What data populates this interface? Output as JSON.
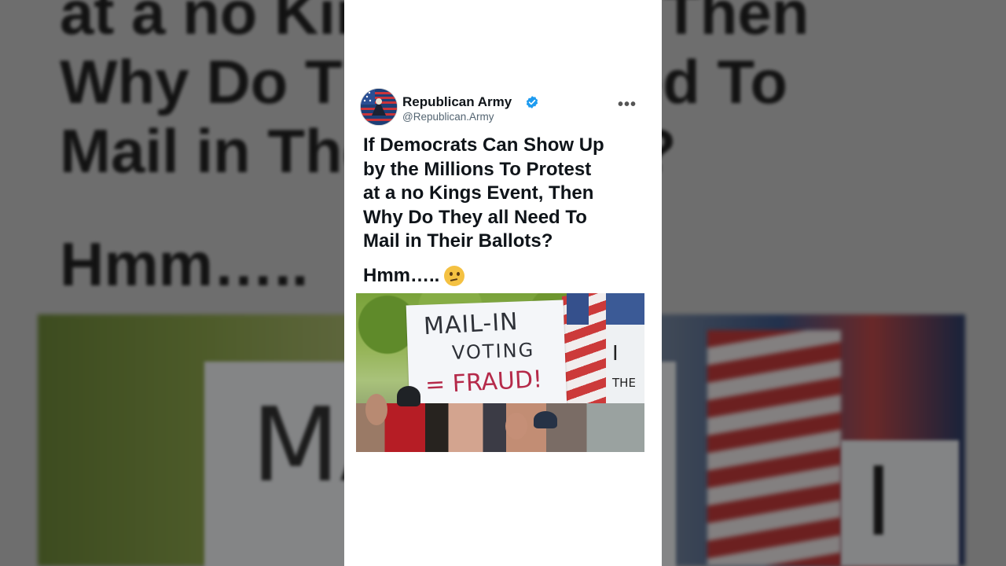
{
  "post": {
    "author_name": "Republican Army",
    "author_handle": "@Republican.Army",
    "verified": true,
    "more_label": "•••",
    "body_lines": [
      "If Democrats Can Show Up",
      "by the Millions To Protest",
      "at a no Kings Event, Then",
      "Why Do They all Need To",
      "Mail in Their Ballots?"
    ],
    "followup": "Hmm…..",
    "followup_emoji": "thinking-face-icon"
  },
  "photo": {
    "sign_line_1": "MAIL-IN",
    "sign_line_2": "VOTING",
    "sign_line_3": "= FRAUD!",
    "side_sign_text": "I\nTHE"
  },
  "background": {
    "line_1": "at a no Kings Event, Then",
    "line_2": "Why Do They all Need To",
    "line_3": "Mail in Their Ballots?",
    "line_4": "Hmm….."
  },
  "colors": {
    "verified_blue": "#1d9bf0",
    "text_primary": "#0f1419",
    "text_secondary": "#536471",
    "card_bg": "#ffffff"
  }
}
